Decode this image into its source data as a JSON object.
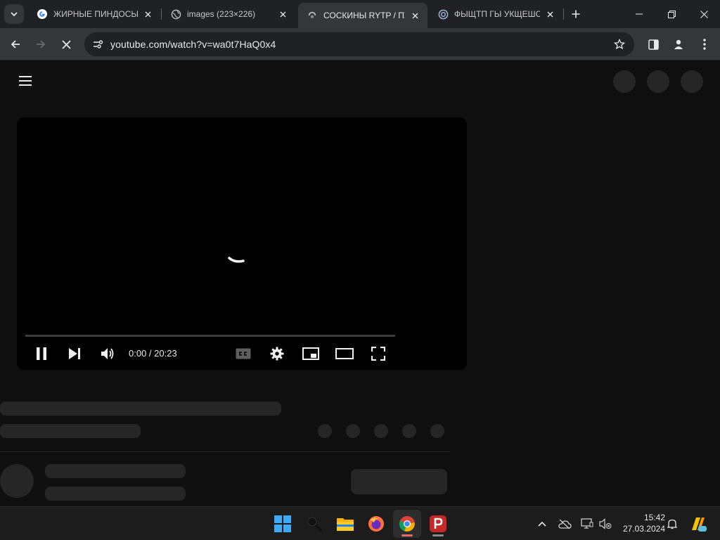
{
  "browser": {
    "tabs": [
      {
        "title": "ЖИРНЫЕ ПИНДОСЫ",
        "icon": "google-icon",
        "active": false
      },
      {
        "title": "images (223×226)",
        "icon": "globe-icon",
        "active": false
      },
      {
        "title": "СОСКИНЫ RYTP / ПУП",
        "icon": "loading-icon",
        "active": true
      },
      {
        "title": "ФЫЩТП ГЫ УКЩЕШС",
        "icon": "edge-icon",
        "active": false
      }
    ],
    "url": "youtube.com/watch?v=wa0t7HaQ0x4"
  },
  "player": {
    "current_time": "0:00",
    "separator": " / ",
    "duration": "20:23",
    "state": "playing",
    "progress_fraction": 0
  },
  "taskbar": {
    "time": "15:42",
    "date": "27.03.2024",
    "apps": [
      "start-icon",
      "search-icon",
      "file-explorer-icon",
      "firefox-icon",
      "chrome-icon",
      "psiphon-icon"
    ]
  },
  "colors": {
    "chrome_frame": "#202124",
    "toolbar": "#35363a",
    "page_bg": "#0f0f0f",
    "skeleton": "#262626",
    "taskbar": "#1c1c1c"
  }
}
